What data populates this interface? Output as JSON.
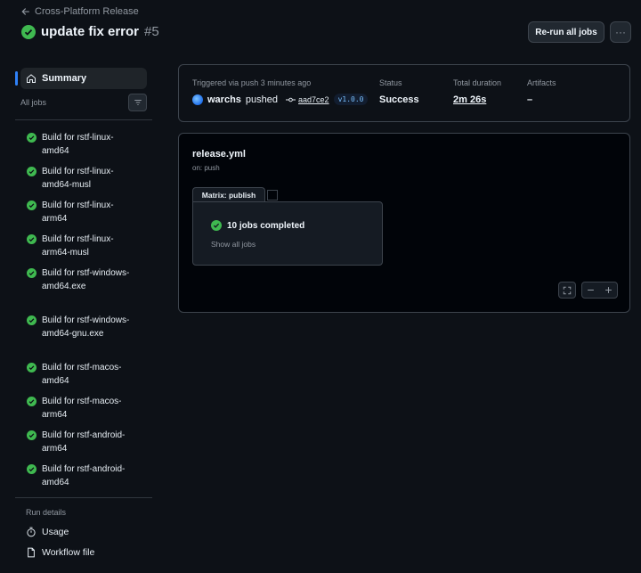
{
  "header": {
    "back_label": "Cross-Platform Release",
    "title": "update fix error",
    "run_number": "#5",
    "rerun_label": "Re-run all jobs",
    "more_label": "···"
  },
  "sidebar": {
    "summary_label": "Summary",
    "all_jobs_label": "All jobs",
    "jobs": [
      {
        "label": "Build for rstf-linux-amd64",
        "status": "success"
      },
      {
        "label": "Build for rstf-linux-amd64-musl",
        "status": "success"
      },
      {
        "label": "Build for rstf-linux-arm64",
        "status": "success"
      },
      {
        "label": "Build for rstf-linux-arm64-musl",
        "status": "success"
      },
      {
        "label": "Build for rstf-windows-amd64.exe",
        "status": "success"
      },
      {
        "label": "Build for rstf-windows-amd64-gnu.exe",
        "status": "success"
      },
      {
        "label": "Build for rstf-macos-amd64",
        "status": "success"
      },
      {
        "label": "Build for rstf-macos-arm64",
        "status": "success"
      },
      {
        "label": "Build for rstf-android-arm64",
        "status": "success"
      },
      {
        "label": "Build for rstf-android-amd64",
        "status": "success"
      }
    ],
    "run_details_label": "Run details",
    "usage_label": "Usage",
    "workflow_file_label": "Workflow file"
  },
  "summary": {
    "trigger_label": "Triggered via push 3 minutes ago",
    "actor": "warchs",
    "action": "pushed",
    "commit": "aad7ce2",
    "tag": "v1.0.0",
    "status_label": "Status",
    "status_value": "Success",
    "duration_label": "Total duration",
    "duration_value": "2m 26s",
    "artifacts_label": "Artifacts",
    "artifacts_value": "–"
  },
  "graph": {
    "workflow_name": "release.yml",
    "trigger": "on: push",
    "matrix_label": "Matrix: publish",
    "jobs_completed": "10 jobs completed",
    "show_all_label": "Show all jobs"
  },
  "colors": {
    "success": "#3fb950",
    "accent": "#2f81f7",
    "background": "#0d1117"
  }
}
